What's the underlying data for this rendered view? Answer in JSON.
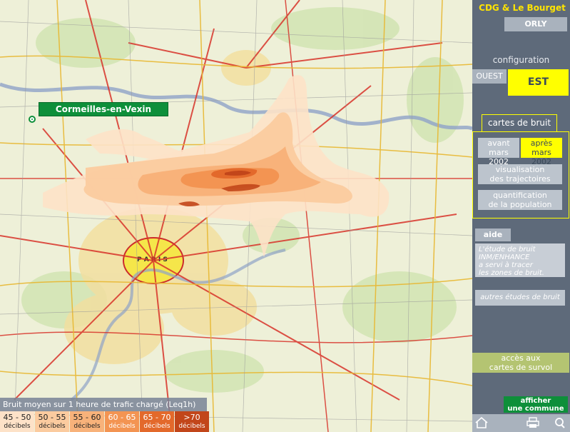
{
  "map": {
    "place_label": "Cormeilles-en-Vexin",
    "city_label": "P A R I S"
  },
  "legend": {
    "title": "Bruit moyen sur 1 heure de trafic chargé (Leq1h)",
    "classes": [
      {
        "range": "45 - 50",
        "unit": "décibels",
        "color": "#fde2c8"
      },
      {
        "range": "50 - 55",
        "unit": "décibels",
        "color": "#fbcb9f"
      },
      {
        "range": "55 - 60",
        "unit": "décibels",
        "color": "#f8b27a"
      },
      {
        "range": "60 - 65",
        "unit": "décibels",
        "color": "#f39452"
      },
      {
        "range": "65 - 70",
        "unit": "décibels",
        "color": "#e3692b"
      },
      {
        "range": ">70",
        "unit": "décibels",
        "color": "#c2461a"
      }
    ]
  },
  "panel": {
    "title": "CDG & Le Bourget",
    "orly": "ORLY",
    "configuration": "configuration",
    "ouest": "OUEST",
    "est": "EST",
    "cartes_de_bruit": "cartes de bruit",
    "avant_l1": "avant",
    "avant_l2": "mars 2002",
    "apres_l1": "après",
    "apres_l2": "mars 2002",
    "visu_l1": "visualisation",
    "visu_l2": "des trajectoires",
    "quant_l1": "quantification",
    "quant_l2": "de la population",
    "aide": "aide",
    "aide_text": [
      "L'étude de bruit",
      "INM/ENHANCE",
      "a servi à tracer",
      "les zones de bruit."
    ],
    "autres": "autres études de bruit",
    "acces_l1": "accès aux",
    "acces_l2": "cartes de survol",
    "afficher_l1": "afficher",
    "afficher_l2": "une commune",
    "icons": [
      "home-icon",
      "print-icon",
      "search-icon"
    ]
  },
  "colors": {
    "accent_yellow": "#ffff00",
    "panel_bg": "#5e6a7a",
    "green": "#0e8f3a"
  }
}
